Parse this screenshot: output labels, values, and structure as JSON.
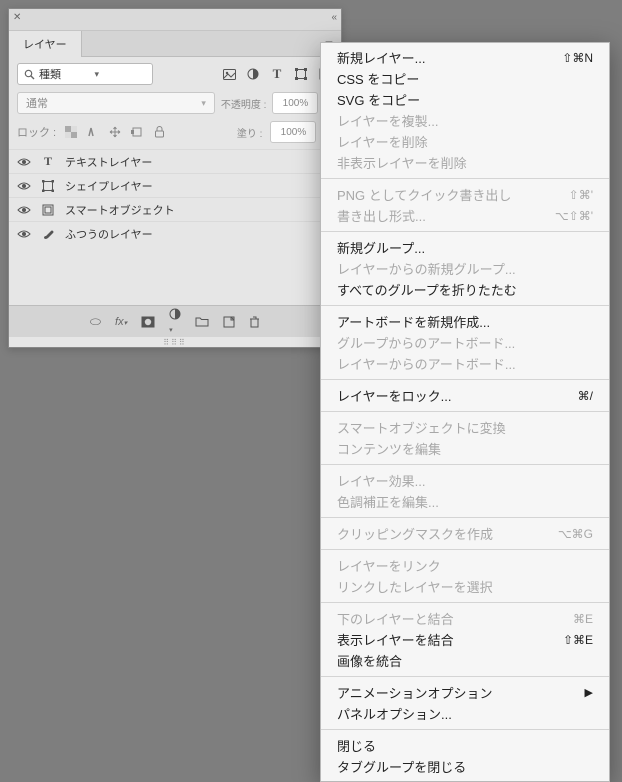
{
  "panel": {
    "tab": "レイヤー",
    "search_label": "種類",
    "blend_mode": "通常",
    "opacity_label": "不透明度 :",
    "opacity_value": "100%",
    "lock_label": "ロック :",
    "fill_label": "塗り :",
    "fill_value": "100%",
    "layers": [
      {
        "name": "テキストレイヤー",
        "icon": "T"
      },
      {
        "name": "シェイプレイヤー",
        "icon": "shape"
      },
      {
        "name": "スマートオブジェクト",
        "icon": "smart"
      },
      {
        "name": "ふつうのレイヤー",
        "icon": "brush"
      }
    ]
  },
  "menu": [
    {
      "label": "新規レイヤー...",
      "shortcut": "⇧⌘N"
    },
    {
      "label": "CSS をコピー"
    },
    {
      "label": "SVG をコピー"
    },
    {
      "label": "レイヤーを複製...",
      "disabled": true
    },
    {
      "label": "レイヤーを削除",
      "disabled": true
    },
    {
      "label": "非表示レイヤーを削除",
      "disabled": true
    },
    {
      "sep": true
    },
    {
      "label": "PNG としてクイック書き出し",
      "shortcut": "⇧⌘'",
      "disabled": true
    },
    {
      "label": "書き出し形式...",
      "shortcut": "⌥⇧⌘'",
      "disabled": true
    },
    {
      "sep": true
    },
    {
      "label": "新規グループ..."
    },
    {
      "label": "レイヤーからの新規グループ...",
      "disabled": true
    },
    {
      "label": "すべてのグループを折りたたむ"
    },
    {
      "sep": true
    },
    {
      "label": "アートボードを新規作成..."
    },
    {
      "label": "グループからのアートボード...",
      "disabled": true
    },
    {
      "label": "レイヤーからのアートボード...",
      "disabled": true
    },
    {
      "sep": true
    },
    {
      "label": "レイヤーをロック...",
      "shortcut": "⌘/"
    },
    {
      "sep": true
    },
    {
      "label": "スマートオブジェクトに変換",
      "disabled": true
    },
    {
      "label": "コンテンツを編集",
      "disabled": true
    },
    {
      "sep": true
    },
    {
      "label": "レイヤー効果...",
      "disabled": true
    },
    {
      "label": "色調補正を編集...",
      "disabled": true
    },
    {
      "sep": true
    },
    {
      "label": "クリッピングマスクを作成",
      "shortcut": "⌥⌘G",
      "disabled": true
    },
    {
      "sep": true
    },
    {
      "label": "レイヤーをリンク",
      "disabled": true
    },
    {
      "label": "リンクしたレイヤーを選択",
      "disabled": true
    },
    {
      "sep": true
    },
    {
      "label": "下のレイヤーと結合",
      "shortcut": "⌘E",
      "disabled": true
    },
    {
      "label": "表示レイヤーを結合",
      "shortcut": "⇧⌘E"
    },
    {
      "label": "画像を統合"
    },
    {
      "sep": true
    },
    {
      "label": "アニメーションオプション",
      "submenu": true
    },
    {
      "label": "パネルオプション..."
    },
    {
      "sep": true
    },
    {
      "label": "閉じる"
    },
    {
      "label": "タブグループを閉じる"
    }
  ]
}
